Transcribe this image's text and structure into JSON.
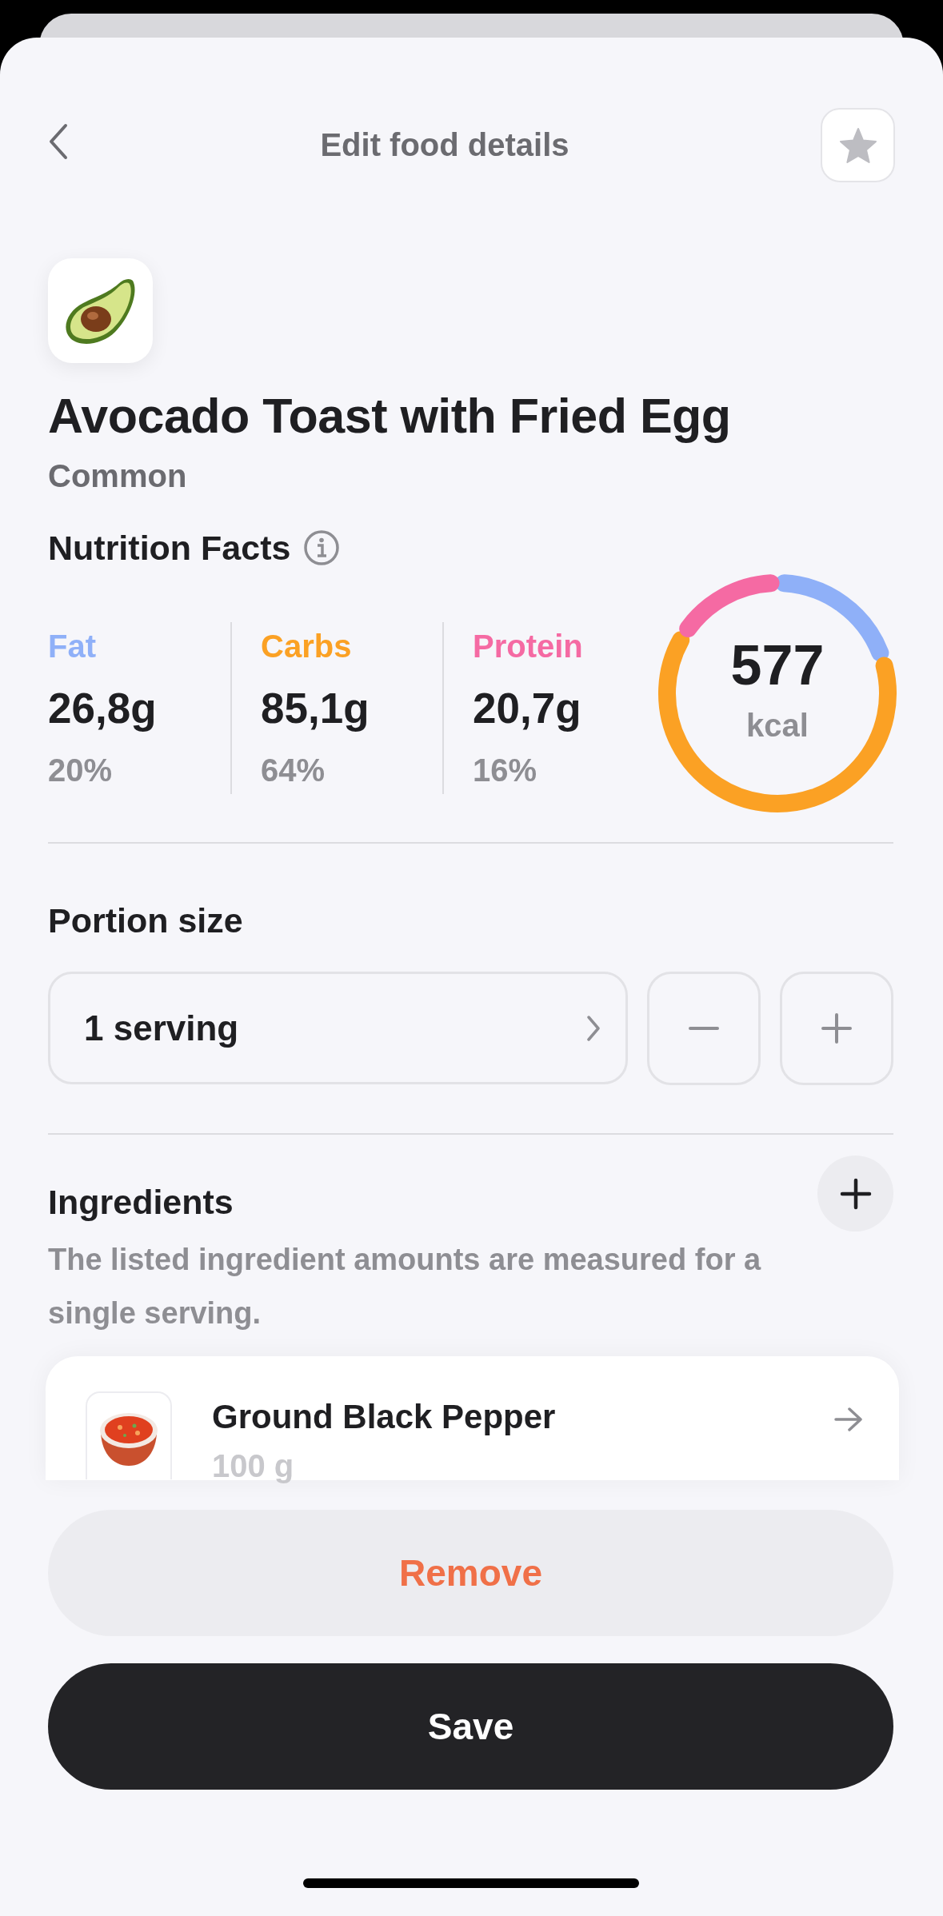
{
  "header": {
    "title": "Edit food details",
    "favorite": false
  },
  "food": {
    "name": "Avocado Toast with Fried Egg",
    "category": "Common"
  },
  "nutrition": {
    "title": "Nutrition Facts",
    "calories": "577",
    "calories_unit": "kcal",
    "macros": [
      {
        "label": "Fat",
        "amount": "26,8g",
        "percent": "20%",
        "color": "#8fb0f8"
      },
      {
        "label": "Carbs",
        "amount": "85,1g",
        "percent": "64%",
        "color": "#fba124"
      },
      {
        "label": "Protein",
        "amount": "20,7g",
        "percent": "16%",
        "color": "#f56aa3"
      }
    ]
  },
  "portion": {
    "title": "Portion size",
    "value": "1 serving"
  },
  "ingredients": {
    "title": "Ingredients",
    "note": "The listed ingredient amounts are measured for a single serving.",
    "items": [
      {
        "name": "Ground Black Pepper",
        "amount": "100 g"
      }
    ]
  },
  "buttons": [
    {
      "label": "Remove",
      "kind": "destructive"
    },
    {
      "label": "Save",
      "kind": "primary"
    }
  ]
}
